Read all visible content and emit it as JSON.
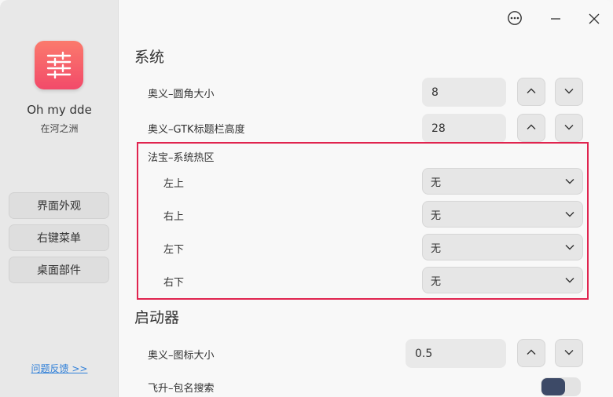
{
  "sidebar": {
    "app_name": "Oh my dde",
    "app_subtitle": "在河之洲",
    "nav": [
      "界面外观",
      "右键菜单",
      "桌面部件"
    ],
    "feedback": "问题反馈  >>"
  },
  "titlebar": {
    "menu_icon": "ellipsis-circle-icon",
    "minimize_icon": "minimize-icon",
    "close_icon": "close-icon"
  },
  "system": {
    "title": "系统",
    "corner_label": "奥义–圆角大小",
    "corner_value": "8",
    "gtk_label": "奥义–GTK标题栏高度",
    "gtk_value": "28",
    "hotzone_label": "法宝–系统热区",
    "hotzones": [
      {
        "label": "左上",
        "value": "无"
      },
      {
        "label": "右上",
        "value": "无"
      },
      {
        "label": "左下",
        "value": "无"
      },
      {
        "label": "右下",
        "value": "无"
      }
    ]
  },
  "launcher": {
    "title": "启动器",
    "icon_size_label": "奥义–图标大小",
    "icon_size_value": "0.5",
    "pkg_search_label": "飞升–包名搜索",
    "pkg_search_enabled": true
  },
  "colors": {
    "accent_red": "#e0244f",
    "toggle_on": "#3d4a67",
    "link_blue": "#2f7fd8"
  }
}
